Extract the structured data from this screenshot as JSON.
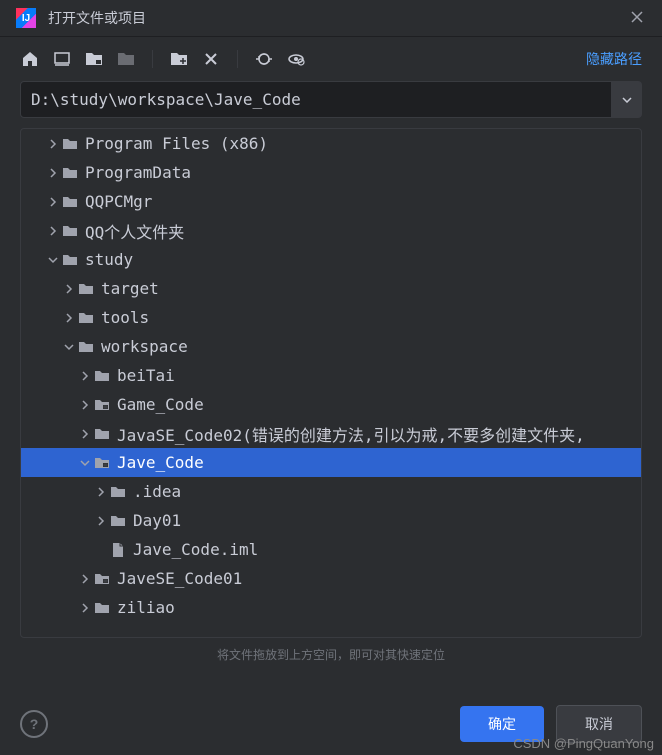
{
  "title": "打开文件或项目",
  "hide_path_label": "隐藏路径",
  "path_value": "D:\\study\\workspace\\Jave_Code",
  "hint": "将文件拖放到上方空间，即可对其快速定位",
  "ok_label": "确定",
  "cancel_label": "取消",
  "help_label": "?",
  "watermark": "CSDN @PingQuanYong",
  "tree": [
    {
      "indent": 1,
      "chevron": "right",
      "icon": "folder",
      "label": "Program Files (x86)"
    },
    {
      "indent": 1,
      "chevron": "right",
      "icon": "folder",
      "label": "ProgramData"
    },
    {
      "indent": 1,
      "chevron": "right",
      "icon": "folder",
      "label": "QQPCMgr"
    },
    {
      "indent": 1,
      "chevron": "right",
      "icon": "folder",
      "label": "QQ个人文件夹"
    },
    {
      "indent": 1,
      "chevron": "down",
      "icon": "folder",
      "label": "study"
    },
    {
      "indent": 2,
      "chevron": "right",
      "icon": "folder",
      "label": "target"
    },
    {
      "indent": 2,
      "chevron": "right",
      "icon": "folder",
      "label": "tools"
    },
    {
      "indent": 2,
      "chevron": "down",
      "icon": "folder",
      "label": "workspace"
    },
    {
      "indent": 3,
      "chevron": "right",
      "icon": "folder",
      "label": "beiTai"
    },
    {
      "indent": 3,
      "chevron": "right",
      "icon": "project",
      "label": "Game_Code"
    },
    {
      "indent": 3,
      "chevron": "right",
      "icon": "folder",
      "label": "JavaSE_Code02(错误的创建方法,引以为戒,不要多创建文件夹,"
    },
    {
      "indent": 3,
      "chevron": "down",
      "icon": "project",
      "label": "Jave_Code",
      "selected": true
    },
    {
      "indent": 4,
      "chevron": "right",
      "icon": "folder",
      "label": ".idea"
    },
    {
      "indent": 4,
      "chevron": "right",
      "icon": "folder",
      "label": "Day01"
    },
    {
      "indent": 4,
      "chevron": "none",
      "icon": "file",
      "label": "Jave_Code.iml"
    },
    {
      "indent": 3,
      "chevron": "right",
      "icon": "project",
      "label": "JaveSE_Code01"
    },
    {
      "indent": 3,
      "chevron": "right",
      "icon": "folder",
      "label": "ziliao"
    }
  ]
}
